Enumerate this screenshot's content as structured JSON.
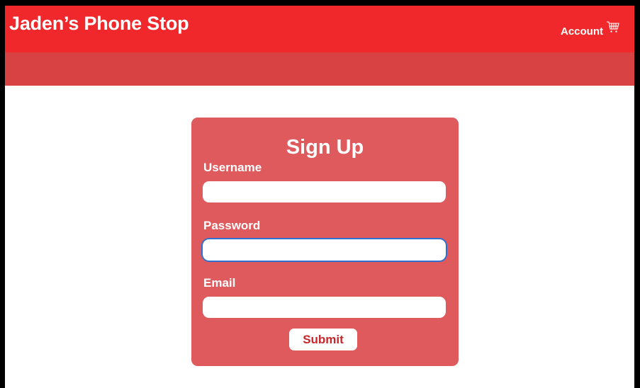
{
  "header": {
    "brand": "Jaden’s Phone Stop",
    "account_label": "Account",
    "cart_icon": "cart-icon"
  },
  "signup": {
    "title": "Sign Up",
    "fields": [
      {
        "label": "Username",
        "value": "",
        "placeholder": ""
      },
      {
        "label": "Password",
        "value": "",
        "placeholder": ""
      },
      {
        "label": "Email",
        "value": "",
        "placeholder": ""
      }
    ],
    "submit_label": "Submit"
  },
  "colors": {
    "header": "#f0282b",
    "subheader": "#d94242",
    "card": "#df5a5d",
    "focus_ring": "#2f6fd0"
  }
}
